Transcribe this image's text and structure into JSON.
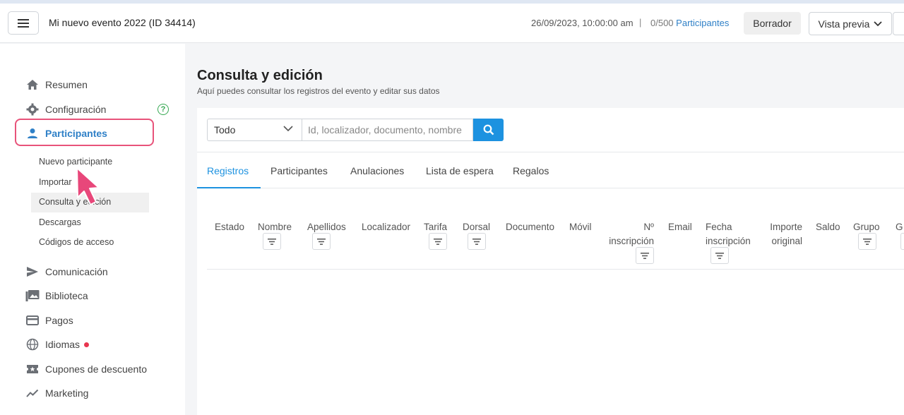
{
  "topbar": {
    "event_title": "Mi nuevo evento 2022 (ID 34414)",
    "event_date": "26/09/2023, 10:00:00 am",
    "separator": "|",
    "count_num": "0/500",
    "count_label": "Participantes",
    "draft_label": "Borrador",
    "preview_label": "Vista previa"
  },
  "sidebar": {
    "items": [
      {
        "label": "Resumen",
        "icon": "home-icon"
      },
      {
        "label": "Configuración",
        "icon": "gear-icon"
      },
      {
        "label": "Participantes",
        "icon": "person-icon"
      },
      {
        "label": "Comunicación",
        "icon": "send-icon"
      },
      {
        "label": "Biblioteca",
        "icon": "photo-library-icon"
      },
      {
        "label": "Pagos",
        "icon": "credit-card-icon"
      },
      {
        "label": "Idiomas",
        "icon": "globe-icon"
      },
      {
        "label": "Cupones de descuento",
        "icon": "ticket-icon"
      },
      {
        "label": "Marketing",
        "icon": "trending-icon"
      }
    ],
    "sub_items": [
      {
        "label": "Nuevo participante"
      },
      {
        "label": "Importar"
      },
      {
        "label": "Consulta y edición"
      },
      {
        "label": "Descargas"
      },
      {
        "label": "Códigos de acceso"
      }
    ],
    "help_mark": "?"
  },
  "main": {
    "title": "Consulta y edición",
    "subtitle": "Aquí puedes consultar los registros del evento y editar sus datos",
    "filter_select": "Todo",
    "search_placeholder": "Id, localizador, documento, nombre",
    "tabs": [
      {
        "label": "Registros"
      },
      {
        "label": "Participantes"
      },
      {
        "label": "Anulaciones"
      },
      {
        "label": "Lista de espera"
      },
      {
        "label": "Regalos"
      }
    ],
    "columns": [
      {
        "label": "Estado"
      },
      {
        "label": "Nombre"
      },
      {
        "label": "Apellidos"
      },
      {
        "label": "Localizador"
      },
      {
        "label": "Tarifa"
      },
      {
        "label": "Dorsal"
      },
      {
        "label": "Documento"
      },
      {
        "label": "Móvil"
      },
      {
        "label": "Nº inscripción"
      },
      {
        "label": "Email"
      },
      {
        "label": "Fecha inscripción"
      },
      {
        "label": "Importe original"
      },
      {
        "label": "Saldo"
      },
      {
        "label": "Grupo"
      },
      {
        "label": "G"
      }
    ]
  },
  "colors": {
    "accent": "#1d92e0",
    "highlight_border": "#e8537a",
    "cursor": "#e8477a"
  }
}
